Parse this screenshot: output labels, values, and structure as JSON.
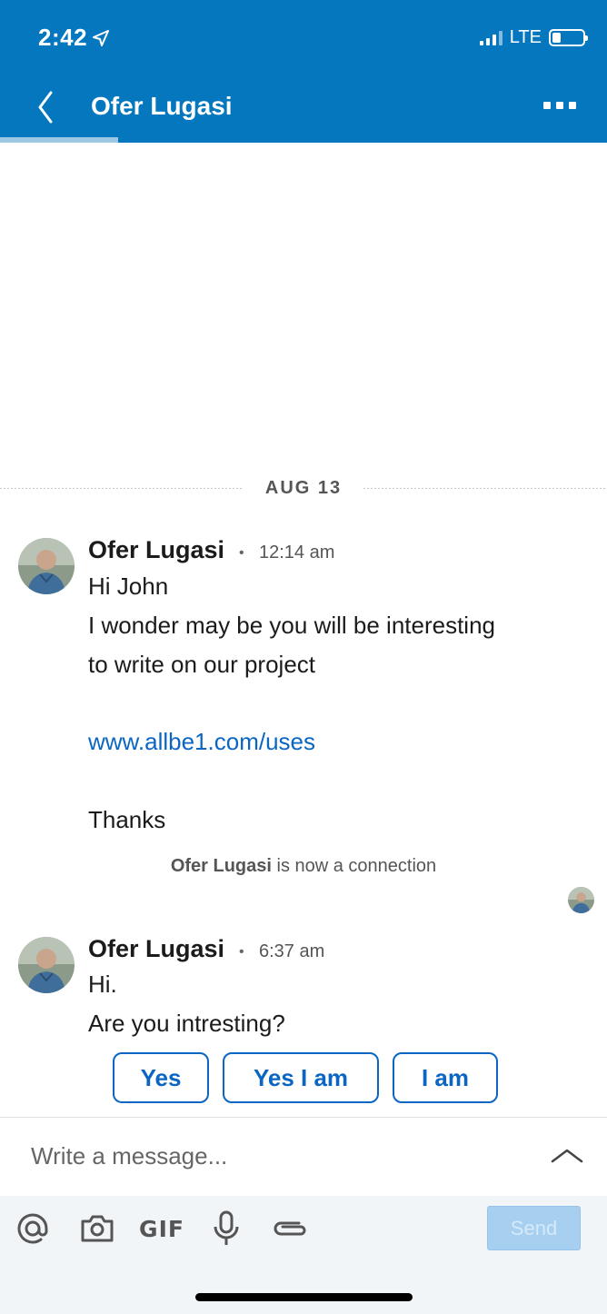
{
  "status_bar": {
    "time": "2:42",
    "network": "LTE"
  },
  "header": {
    "title": "Ofer Lugasi"
  },
  "divider": {
    "date": "AUG 13"
  },
  "messages": [
    {
      "sender": "Ofer Lugasi",
      "time": "12:14 am",
      "lines": [
        "Hi John",
        "I wonder may be you will be interesting",
        "to write on our project"
      ],
      "link": "www.allbe1.com/uses",
      "closing": "Thanks"
    },
    {
      "sender": "Ofer Lugasi",
      "time": "6:37 am",
      "lines": [
        "Hi.",
        "Are you intresting?"
      ]
    }
  ],
  "system_message": {
    "name": "Ofer Lugasi",
    "text": " is now a connection"
  },
  "separator": "•",
  "quick_replies": [
    "Yes",
    "Yes I am",
    "I am"
  ],
  "composer": {
    "placeholder": "Write a message...",
    "gif_label": "GIF",
    "send_label": "Send"
  },
  "colors": {
    "header": "#0477be",
    "link": "#0a66c2",
    "send_disabled": "#a7cff0"
  }
}
